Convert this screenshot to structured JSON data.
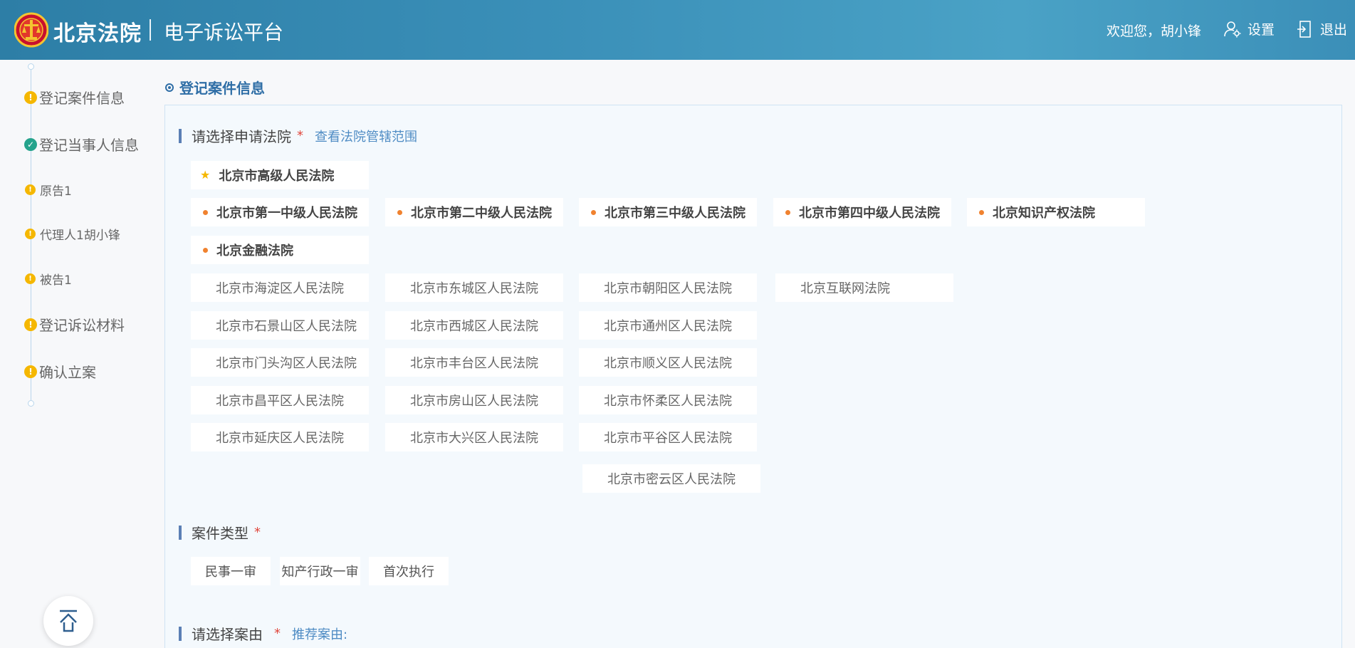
{
  "header": {
    "brand": "北京法院",
    "subtitle": "电子诉讼平台",
    "welcome": "欢迎您，胡小锋",
    "settings_label": "设置",
    "logout_label": "退出"
  },
  "steps": [
    {
      "label": "登记案件信息",
      "status": "warn",
      "kind": "main"
    },
    {
      "label": "登记当事人信息",
      "status": "ok",
      "kind": "main"
    },
    {
      "label": "原告1",
      "status": "warn",
      "kind": "sub"
    },
    {
      "label": "代理人1胡小锋",
      "status": "warn",
      "kind": "sub"
    },
    {
      "label": "被告1",
      "status": "warn",
      "kind": "sub"
    },
    {
      "label": "登记诉讼材料",
      "status": "warn",
      "kind": "main"
    },
    {
      "label": "确认立案",
      "status": "warn",
      "kind": "main"
    }
  ],
  "section_title": "登记案件信息",
  "court_group": {
    "title": "请选择申请法院",
    "required_mark": "*",
    "link": "查看法院管辖范围"
  },
  "courts": {
    "high": "北京市高级人民法院",
    "intermediate": [
      "北京市第一中级人民法院",
      "北京市第二中级人民法院",
      "北京市第三中级人民法院",
      "北京市第四中级人民法院",
      "北京知识产权法院"
    ],
    "finance": "北京金融法院",
    "district": [
      "北京市海淀区人民法院",
      "北京市东城区人民法院",
      "北京市朝阳区人民法院",
      "北京互联网法院",
      "北京市石景山区人民法院",
      "北京市西城区人民法院",
      "北京市通州区人民法院",
      "北京市门头沟区人民法院",
      "北京市丰台区人民法院",
      "北京市顺义区人民法院",
      "北京市昌平区人民法院",
      "北京市房山区人民法院",
      "北京市怀柔区人民法院",
      "北京市延庆区人民法院",
      "北京市大兴区人民法院",
      "北京市平谷区人民法院",
      "北京市密云区人民法院"
    ]
  },
  "case_type_group": {
    "title": "案件类型",
    "required_mark": "*",
    "options": [
      "民事一审",
      "知产行政一审",
      "首次执行"
    ]
  },
  "cause_group": {
    "title": "请选择案由",
    "required_mark": "*",
    "link": "推荐案由:"
  },
  "colors": {
    "header": "#3a8fb8",
    "accent": "#2f6ea6",
    "warn": "#f5b700",
    "ok": "#25a38c",
    "marker": "#f0822f",
    "required": "#e0463b"
  }
}
